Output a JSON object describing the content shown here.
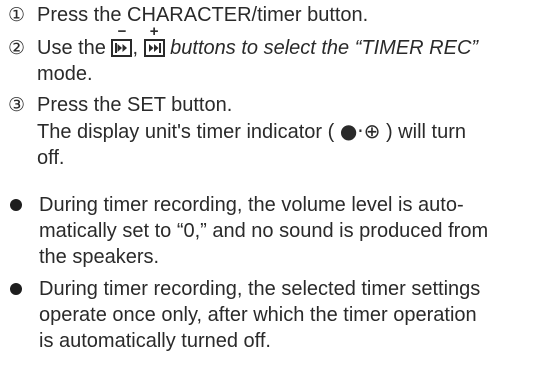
{
  "steps": [
    {
      "num": "①",
      "pre": "Press the ",
      "mark_char": "C",
      "rest": "HARACTER/timer button."
    },
    {
      "num": "②",
      "pre": "Use the ",
      "icon1": "skip-back-icon",
      "icon1_mark": "−",
      "sep": ", ",
      "icon2": "skip-forward-icon",
      "icon2_mark": "+",
      "mid": " buttons to select the “TIMER REC”",
      "line2": "mode."
    },
    {
      "num": "③",
      "line1": "Press the SET button.",
      "line2_pre": "The display unit's timer indicator ( ",
      "indicator": "●·⊕",
      "line2_post": " ) will turn",
      "line3": "off."
    }
  ],
  "notes": [
    {
      "lines": [
        "During timer recording, the volume level is auto-",
        "matically set to “0,” and no sound is produced from",
        "the speakers."
      ]
    },
    {
      "lines": [
        "During timer recording, the selected timer settings",
        "operate once only, after which the timer operation",
        "is automatically turned off."
      ]
    }
  ]
}
